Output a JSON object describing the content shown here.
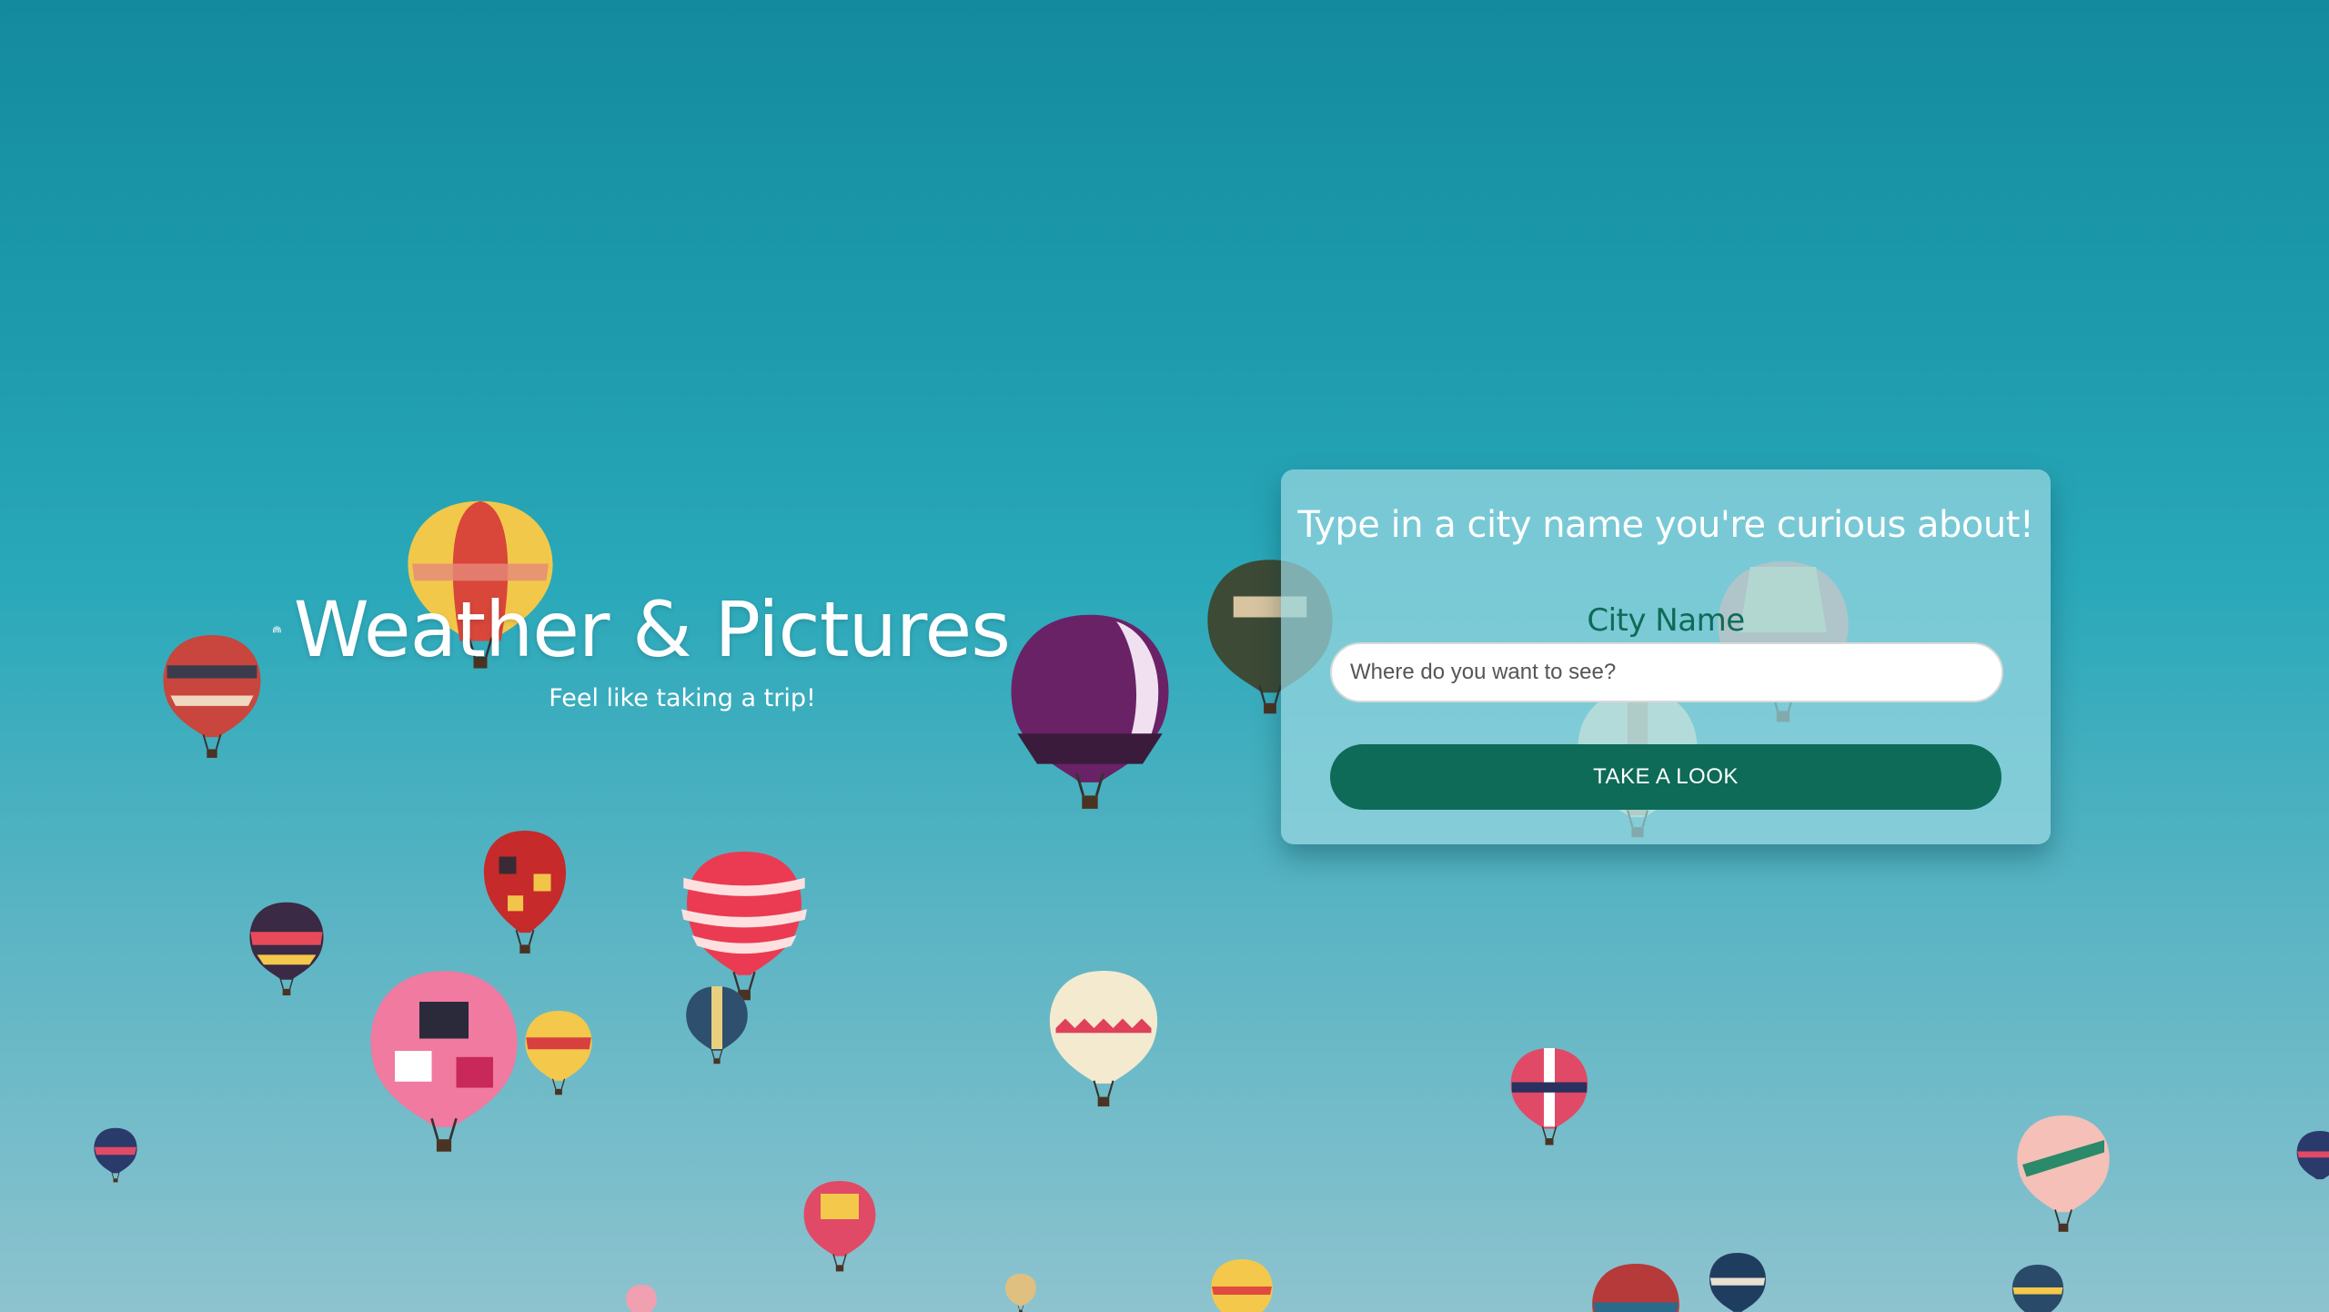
{
  "brand": {
    "title": "Weather & Pictures",
    "tagline": "Feel like taking a trip!",
    "logo_icon": "rainbow-icon"
  },
  "search_card": {
    "heading": "Type in a city name you're curious about!",
    "field_label": "City Name",
    "input_placeholder": "Where do you want to see?",
    "input_value": "",
    "submit_label": "TAKE A LOOK"
  },
  "background": {
    "description_icon": "hot-air-balloon-icon"
  },
  "colors": {
    "sky_top": "#148a9e",
    "sky_bottom": "#8dc3cf",
    "accent_green": "#0d6b58",
    "card_bg": "rgba(152,215,225,0.72)"
  }
}
